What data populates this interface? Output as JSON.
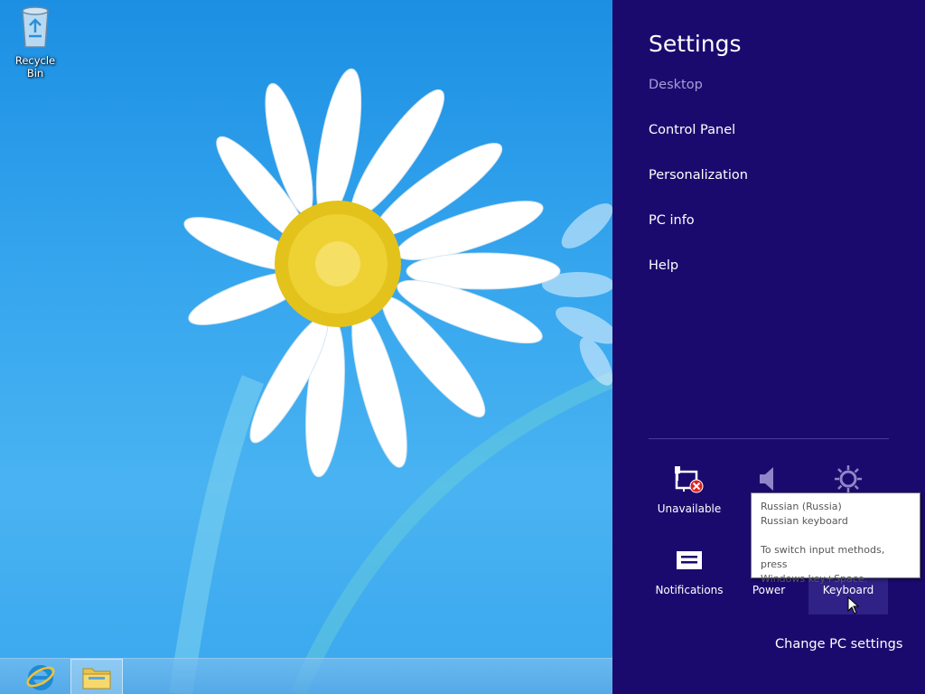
{
  "desktop": {
    "icons": [
      {
        "label": "Recycle Bin",
        "icon": "recycle-bin-icon"
      }
    ]
  },
  "taskbar": {
    "pinned": [
      {
        "name": "internet-explorer-icon"
      },
      {
        "name": "file-explorer-icon",
        "active": true
      }
    ]
  },
  "charm": {
    "title": "Settings",
    "section": "Desktop",
    "items": [
      "Control Panel",
      "Personalization",
      "PC info",
      "Help"
    ],
    "tiles": [
      {
        "label": "Unavailable",
        "icon": "network-unavailable-icon"
      },
      {
        "label": "",
        "icon": "volume-icon"
      },
      {
        "label": "",
        "icon": "brightness-icon"
      },
      {
        "label": "Notifications",
        "icon": "notifications-icon"
      },
      {
        "label": "Power",
        "icon": "power-icon"
      },
      {
        "label": "Keyboard",
        "icon": "keyboard-icon"
      }
    ],
    "change_pc_settings": "Change PC settings",
    "background": "#1b0a6e"
  },
  "tooltip": {
    "line1": "Russian (Russia)",
    "line2": "Russian keyboard",
    "line3": "To switch input methods, press",
    "line4": "Windows key+Space."
  }
}
